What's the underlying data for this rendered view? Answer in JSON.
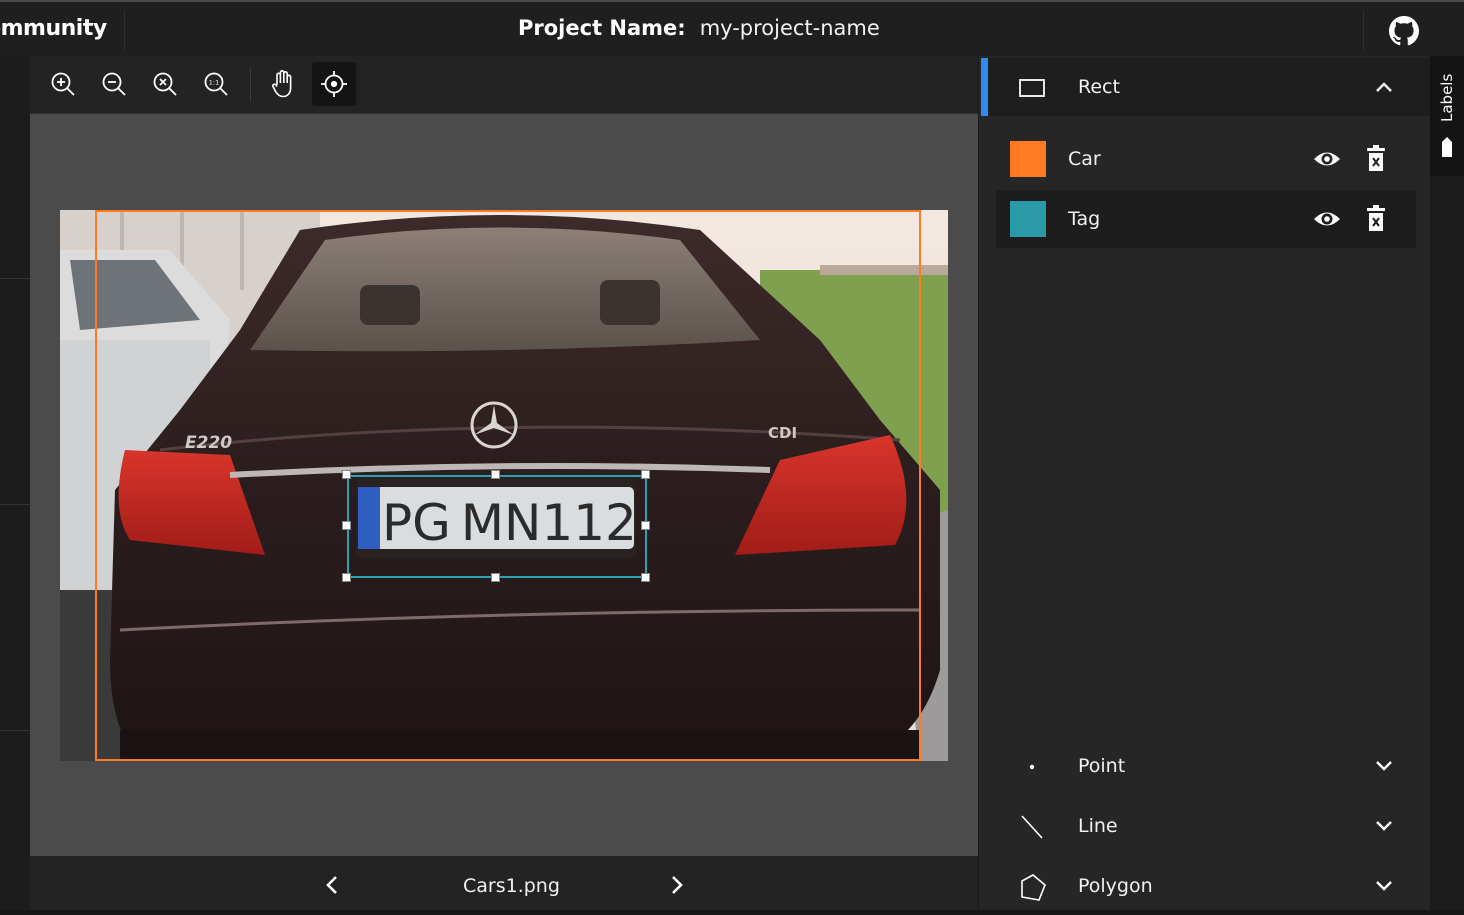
{
  "header": {
    "brand": "ommunity",
    "project_label": "Project Name:",
    "project_name": "my-project-name"
  },
  "toolbar": {
    "tools": [
      "zoom-in-icon",
      "zoom-out-icon",
      "zoom-fit-icon",
      "zoom-actual-icon",
      "pan-hand-icon",
      "crosshair-icon"
    ],
    "active_tool": "crosshair-icon"
  },
  "image": {
    "filename": "Cars1.png",
    "plate_text": "PG MN112",
    "badge_left": "E220",
    "badge_right": "CDI"
  },
  "panel": {
    "sections": [
      {
        "title": "Rect",
        "icon": "rectangle-icon",
        "expanded": true
      },
      {
        "title": "Point",
        "icon": "point-icon",
        "expanded": false
      },
      {
        "title": "Line",
        "icon": "line-icon",
        "expanded": false
      },
      {
        "title": "Polygon",
        "icon": "polygon-icon",
        "expanded": false
      }
    ],
    "labels": [
      {
        "name": "Car",
        "color": "#ff7a22"
      },
      {
        "name": "Tag",
        "color": "#2a9aa8"
      }
    ]
  },
  "side_tab": {
    "label": "Labels"
  }
}
